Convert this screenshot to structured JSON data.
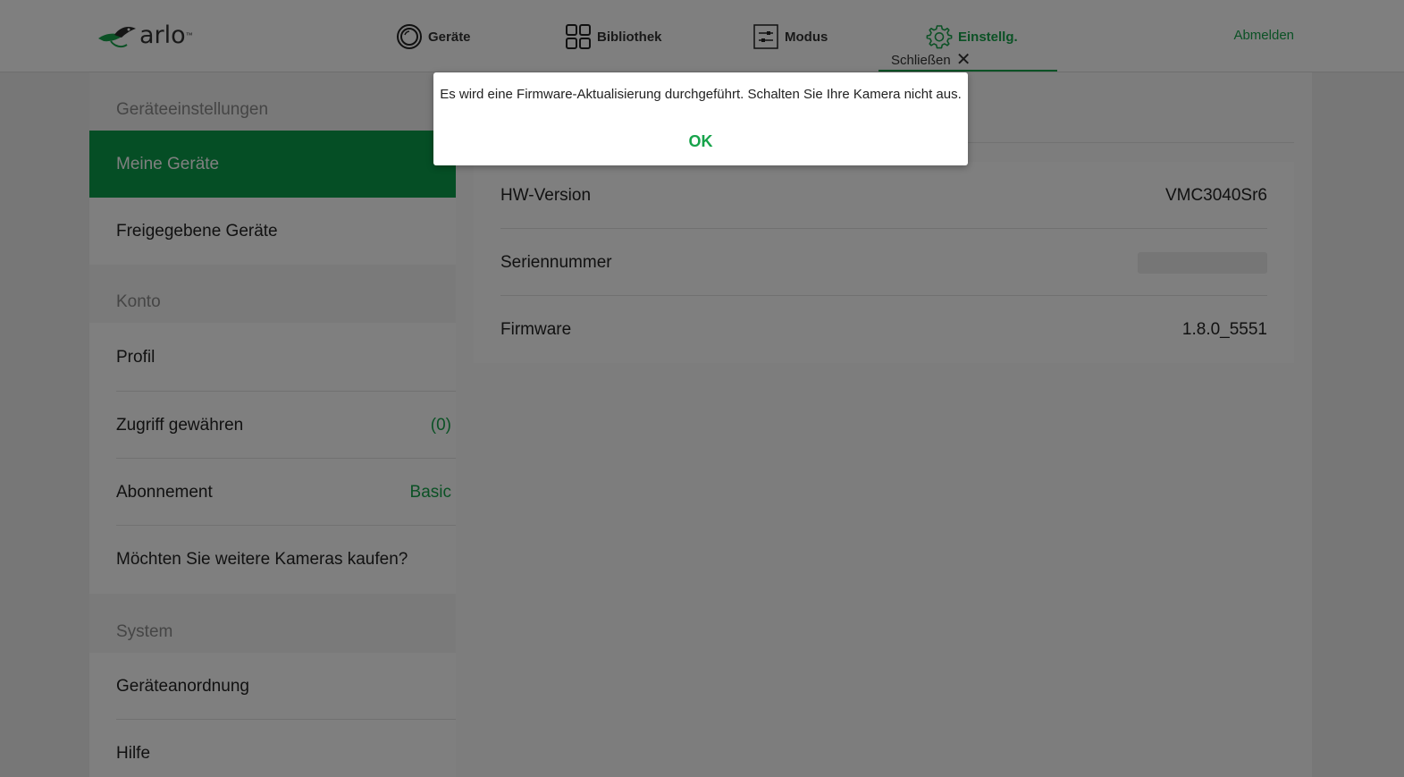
{
  "header": {
    "logo_text": "arlo",
    "logo_tm": "™",
    "nav": [
      {
        "label": "Geräte",
        "icon": "camera-icon"
      },
      {
        "label": "Bibliothek",
        "icon": "grid-icon"
      },
      {
        "label": "Modus",
        "icon": "sliders-icon"
      },
      {
        "label": "Einstellg.",
        "icon": "gear-icon"
      }
    ],
    "logout_label": "Abmelden",
    "close_label": "Schließen",
    "close_glyph": "✕"
  },
  "sidebar": {
    "sections": [
      {
        "title": "Geräteeinstellungen"
      },
      {
        "title": "Konto"
      },
      {
        "title": "System"
      }
    ],
    "items": [
      {
        "label": "Meine Geräte"
      },
      {
        "label": "Freigegebene Geräte"
      },
      {
        "label": "Profil"
      },
      {
        "label": "Zugriff gewähren",
        "value": "(0)"
      },
      {
        "label": "Abonnement",
        "value": "Basic"
      },
      {
        "label": "Möchten Sie weitere Kameras kaufen?"
      },
      {
        "label": "Geräteanordnung"
      },
      {
        "label": "Hilfe"
      }
    ]
  },
  "device_info": {
    "rows": [
      {
        "label": "HW-Version",
        "value": "VMC3040Sr6"
      },
      {
        "label": "Seriennummer"
      },
      {
        "label": "Firmware",
        "value": "1.8.0_5551"
      }
    ]
  },
  "dialog": {
    "message": "Es wird eine Firmware-Aktualisierung durchgeführt. Schalten Sie Ihre Kamera nicht aus.",
    "ok_label": "OK"
  },
  "colors": {
    "accent": "#16a34a",
    "active_item": "#0a9d4a"
  }
}
